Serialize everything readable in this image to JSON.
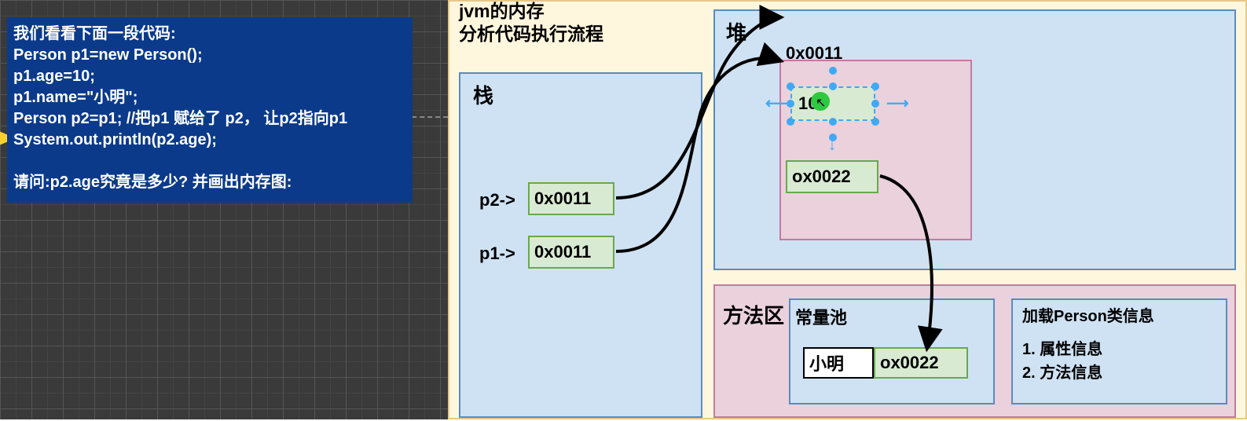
{
  "code_box": {
    "intro": "我们看看下面一段代码:",
    "line1": "Person p1=new Person();",
    "line2": "p1.age=10;",
    "line3": "p1.name=\"小明\";",
    "line4": "Person p2=p1; //把p1 赋给了 p2，  让p2指向p1",
    "line5": "System.out.println(p2.age);",
    "question": "请问:p2.age究竟是多少? 并画出内存图:"
  },
  "diagram": {
    "title_line1": "jvm的内存",
    "title_line2": "分析代码执行流程",
    "stack_label": "栈",
    "heap_label": "堆",
    "heap_address": "0x0011",
    "age_value": "10",
    "name_ref_value": "ox0022",
    "p2_label": "p2->",
    "p2_addr": "0x0011",
    "p1_label": "p1->",
    "p1_addr": "0x0011",
    "method_area_label": "方法区",
    "constant_pool_label": "常量池",
    "const_entry_value": "小明",
    "const_entry_addr": "ox0022",
    "class_info_title": "加载Person类信息",
    "class_info_item1": "1. 属性信息",
    "class_info_item2": "2. 方法信息"
  }
}
